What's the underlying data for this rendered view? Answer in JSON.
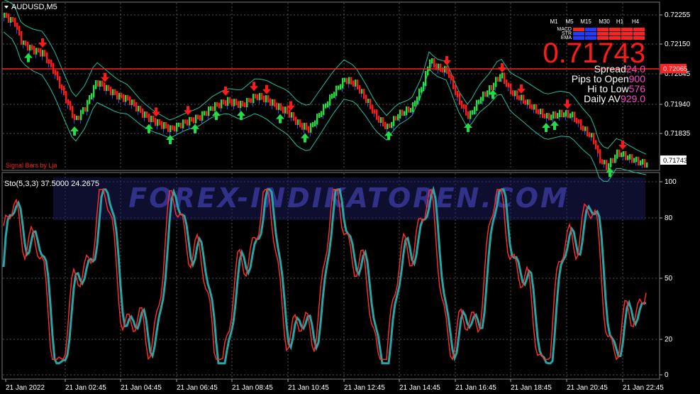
{
  "window": {
    "symbol_title": "AUDUSD,M5"
  },
  "main_panel": {
    "signal_label": "Signal Bars by Lja",
    "big_price": "0.71743",
    "info": [
      {
        "label": "Spread",
        "value": "24.0"
      },
      {
        "label": "Pips to Open",
        "value": "900"
      },
      {
        "label": "Hi to Low",
        "value": "576"
      },
      {
        "label": "Daily AV",
        "value": "929.0"
      }
    ],
    "timeframes": [
      "M1",
      "M5",
      "M15",
      "M30",
      "H1",
      "H4"
    ],
    "tf_rows": [
      "MACD",
      "STR",
      "EMA"
    ],
    "price_levels": [
      "0.72255",
      "0.72150",
      "0.72045",
      "0.71940",
      "0.71835"
    ],
    "red_line_price": "0.72065",
    "current_price": "0.71743",
    "colors": {
      "bull": "#22dd44",
      "bear": "#ff1a1a",
      "band": "#1fbfa0",
      "level": "#ff2020"
    }
  },
  "indicator_panel": {
    "title": "Sto(5,3,3) 37.5000 24.2675",
    "levels": [
      "100",
      "80",
      "50",
      "20",
      "0"
    ],
    "colors": {
      "main": "#ff2a2a",
      "signal": "#27a6a6"
    }
  },
  "watermark": "FOREX-INDIKATOREN.COM",
  "time_axis": [
    "21 Jan 2022",
    "21 Jan 02:45",
    "21 Jan 04:45",
    "21 Jan 06:45",
    "21 Jan 08:45",
    "21 Jan 10:45",
    "21 Jan 12:45",
    "21 Jan 14:45",
    "21 Jan 16:45",
    "21 Jan 18:45",
    "21 Jan 20:45",
    "21 Jan 22:45"
  ]
}
